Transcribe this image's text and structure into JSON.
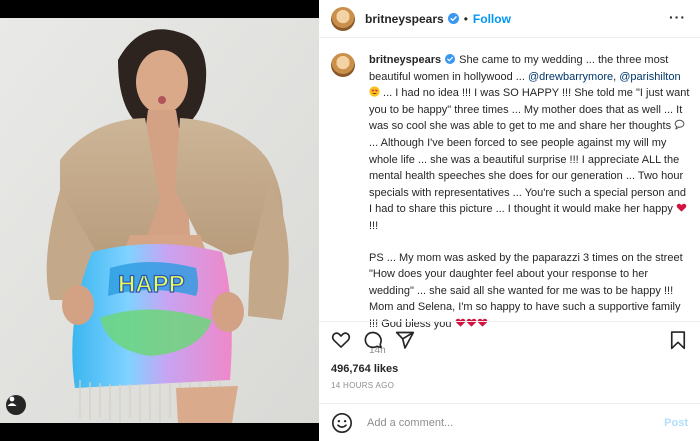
{
  "post": {
    "username": "britneyspears",
    "follow_label": "Follow",
    "dot": "•",
    "more_icon": "more-horizontal-icon"
  },
  "caption": {
    "username": "britneyspears",
    "p1_a": "She came to my wedding ... the three most beautiful women in hollywood ... ",
    "mention1": "@drewbarrymore",
    "p1_b": ", ",
    "mention2": "@parishilton",
    "p1_c": " ... I had no idea !!! I was SO HAPPY !!! She told me \"I just want you to be happy\" three times ... My mother does that as well ... It was so cool she was able to get to me and share her thoughts ",
    "p1_d": "... Although I've been forced to see people against my will my whole life ... she was a beautiful surprise !!! I appreciate ALL the mental health speeches she does for our generation ... Two hour specials with representatives ... You're such a special person and I had to share this picture ... I thought it would make her happy ",
    "p1_e": " !!!",
    "p2_a": "PS ... My mom was asked by the paparazzi 3 times on the street \"How does your daughter feel about your response to her wedding\" ... she said all she wanted for me was to be happy !!! Mom and Selena, I'm so happy to have such a supportive family !!! God bless you ",
    "time": "14h"
  },
  "stats": {
    "likes": "496,764 likes",
    "ago": "14 HOURS AGO"
  },
  "comment": {
    "placeholder": "Add a comment...",
    "post_label": "Post"
  },
  "colors": {
    "link": "#0095f6",
    "mention": "#00376b",
    "heart": "#d3123f",
    "muted": "#8e8e8e"
  }
}
